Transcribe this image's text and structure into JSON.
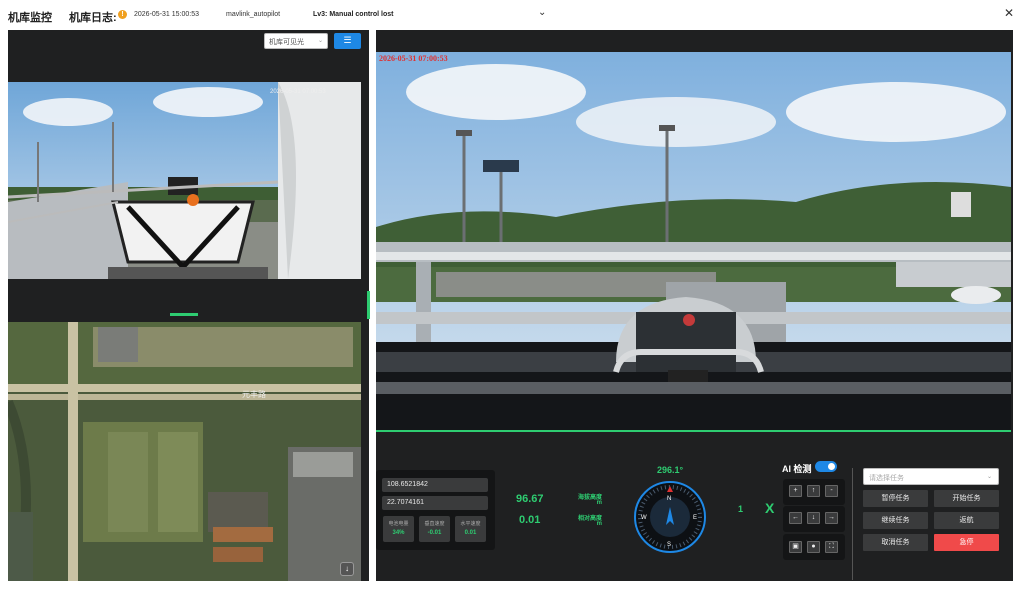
{
  "header": {
    "title": "机库监控",
    "log_label": "机库日志:",
    "log_time": "2026-05-31 15:00:53",
    "log_source": "mavlink_autopilot",
    "log_message": "Lv3: Manual control lost"
  },
  "left_camera": {
    "source_select": "机库可见光",
    "timestamp": "2026-05-31 07:00:53"
  },
  "map": {
    "road_label": "元丰路"
  },
  "main_camera": {
    "timestamp": "2026-05-31 07:00:53"
  },
  "telemetry": {
    "longitude": "108.6521842",
    "latitude": "22.7074161",
    "stats": [
      {
        "label": "电池电量",
        "value": "34%"
      },
      {
        "label": "垂直速度",
        "value": "-0.01"
      },
      {
        "label": "水平速度",
        "value": "0.01"
      }
    ],
    "altitude_sea": "96.67",
    "altitude_sea_label": "海拔高度",
    "altitude_rel": "0.01",
    "altitude_rel_label": "相对高度",
    "unit": "m",
    "heading": "296.1°",
    "mode_value": "1",
    "mode_mark": "X"
  },
  "ai": {
    "label": "AI 检测",
    "enabled": true
  },
  "pad": {
    "row1": [
      "+",
      "↑",
      "-"
    ],
    "row2": [
      "←",
      "↓",
      "→"
    ],
    "row3": [
      "camera-icon",
      "record-icon",
      "fullscreen-icon"
    ]
  },
  "tasks": {
    "select_placeholder": "请选择任务",
    "pause": "暂停任务",
    "start": "开始任务",
    "resume": "继续任务",
    "return": "返航",
    "cancel": "取消任务",
    "emergency_stop": "急停"
  },
  "colors": {
    "accent_green": "#2ecc71",
    "accent_blue": "#1e88e5",
    "danger_red": "#f04a4a",
    "panel_dark": "#1f2021"
  }
}
